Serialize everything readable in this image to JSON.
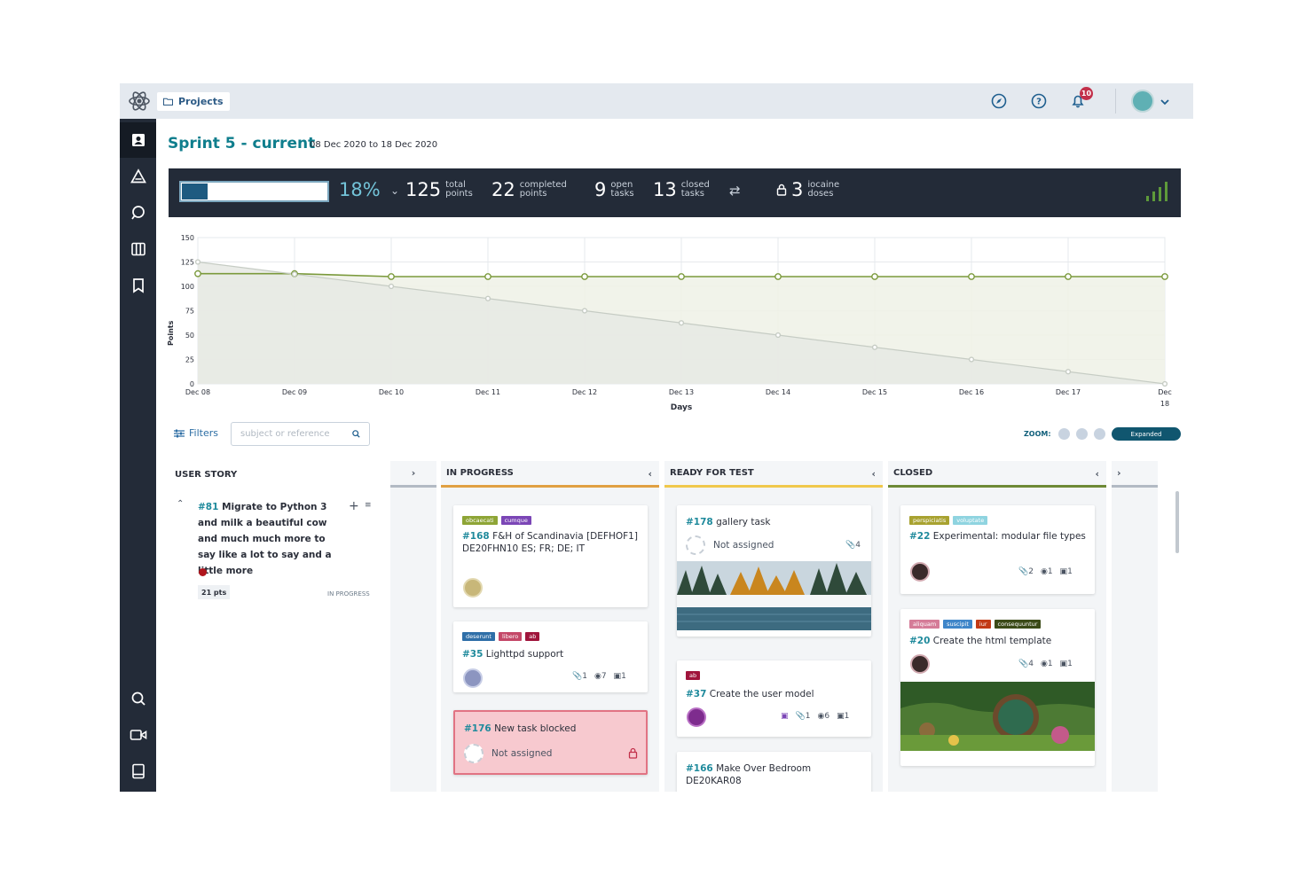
{
  "topbar": {
    "breadcrumb": "Projects",
    "notifications_count": "10",
    "icons": [
      "discover-icon",
      "help-icon",
      "bell-icon"
    ]
  },
  "sidebar": {
    "items": [
      "scrum-icon",
      "issues-icon",
      "search-discussion-icon",
      "kanban-icon",
      "wiki-icon"
    ],
    "bottom_items": [
      "search-icon",
      "video-icon",
      "team-book-icon"
    ]
  },
  "sprint": {
    "title": "Sprint 5 - current",
    "dates": "08 Dec 2020 to 18 Dec 2020"
  },
  "stats": {
    "progress_percent": 18,
    "percent_label": "18%",
    "total_points": "125",
    "total_label_1": "total",
    "total_label_2": "points",
    "completed_points": "22",
    "completed_label_1": "completed",
    "completed_label_2": "points",
    "open_tasks": "9",
    "open_label_1": "open",
    "open_label_2": "tasks",
    "closed_tasks": "13",
    "closed_label_1": "closed",
    "closed_label_2": "tasks",
    "iocaine": "3",
    "iocaine_label_1": "iocaine",
    "iocaine_label_2": "doses"
  },
  "chart_data": {
    "type": "line",
    "x": [
      "Dec 08",
      "Dec 09",
      "Dec 10",
      "Dec 11",
      "Dec 12",
      "Dec 13",
      "Dec 14",
      "Dec 15",
      "Dec 16",
      "Dec 17",
      "Dec 18"
    ],
    "x_tick_labels": [
      "Dec 08",
      "Dec 09",
      "Dec 10",
      "Dec 11",
      "Dec 12",
      "Dec 13",
      "Dec 14",
      "Dec 15",
      "Dec 16",
      "Dec 17",
      "Dec",
      "18"
    ],
    "xlabel": "Days",
    "ylabel": "Points",
    "ylim": [
      0,
      150
    ],
    "yticks": [
      0,
      25,
      50,
      75,
      100,
      125,
      150
    ],
    "grid": true,
    "series": [
      {
        "values": [
          113,
          113,
          110,
          110,
          110,
          110,
          110,
          110,
          110,
          110,
          110
        ],
        "color": "#7b9a3c"
      },
      {
        "values": [
          125,
          112.5,
          100,
          87.5,
          75,
          62.5,
          50,
          37.5,
          25,
          12.5,
          0
        ],
        "color": "#c6ccc4"
      }
    ]
  },
  "filters": {
    "label": "Filters",
    "search_placeholder": "subject or reference",
    "zoom_label": "ZOOM:",
    "zoom_mode": "Expanded"
  },
  "columns": {
    "user_story": "USER STORY",
    "in_progress": "IN PROGRESS",
    "ready_for_test": "READY FOR TEST",
    "closed": "CLOSED"
  },
  "user_story": {
    "ref": "#81",
    "title": "Migrate to Python 3 and milk a beautiful cow and much much more to say like a lot to say and a little more",
    "points": "21 pts",
    "status": "IN PROGRESS"
  },
  "cards": {
    "c168": {
      "tags": [
        "obcaecati",
        "cumque"
      ],
      "tag_colors": [
        "#8ea536",
        "#7b46b6"
      ],
      "ref": "#168",
      "title": "F&H of Scandinavia [DEFHOF1] DE20FHN10 ES; FR; DE; IT"
    },
    "c35": {
      "tags": [
        "deserunt",
        "libero",
        "ab"
      ],
      "tag_colors": [
        "#2f6fa8",
        "#c44868",
        "#a0153c"
      ],
      "ref": "#35",
      "title": "Lighttpd support",
      "attachments": "1",
      "watchers": "7",
      "comments": "1"
    },
    "c176": {
      "ref": "#176",
      "title": "New task blocked",
      "assignee": "Not assigned"
    },
    "c178": {
      "ref": "#178",
      "title": "gallery task",
      "assignee": "Not assigned",
      "attachments": "4"
    },
    "c37": {
      "tags": [
        "ab"
      ],
      "tag_colors": [
        "#a0153c"
      ],
      "ref": "#37",
      "title": "Create the user model",
      "attachments": "1",
      "watchers": "6",
      "comments": "1"
    },
    "c166": {
      "ref": "#166",
      "title": "Make Over Bedroom DE20KAR08"
    },
    "c22": {
      "tags": [
        "perspiciatis",
        "voluptate"
      ],
      "tag_colors": [
        "#a8a230",
        "#8fd4e0"
      ],
      "ref": "#22",
      "title": "Experimental: modular file types",
      "attachments": "2",
      "watchers": "1",
      "comments": "1"
    },
    "c20": {
      "tags": [
        "aliquam",
        "suscipit",
        "iur",
        "consequuntur"
      ],
      "tag_colors": [
        "#d57c98",
        "#3f86c9",
        "#c23a16",
        "#3b4a17"
      ],
      "ref": "#20",
      "title": "Create the html template",
      "attachments": "4",
      "watchers": "1",
      "comments": "1"
    }
  }
}
